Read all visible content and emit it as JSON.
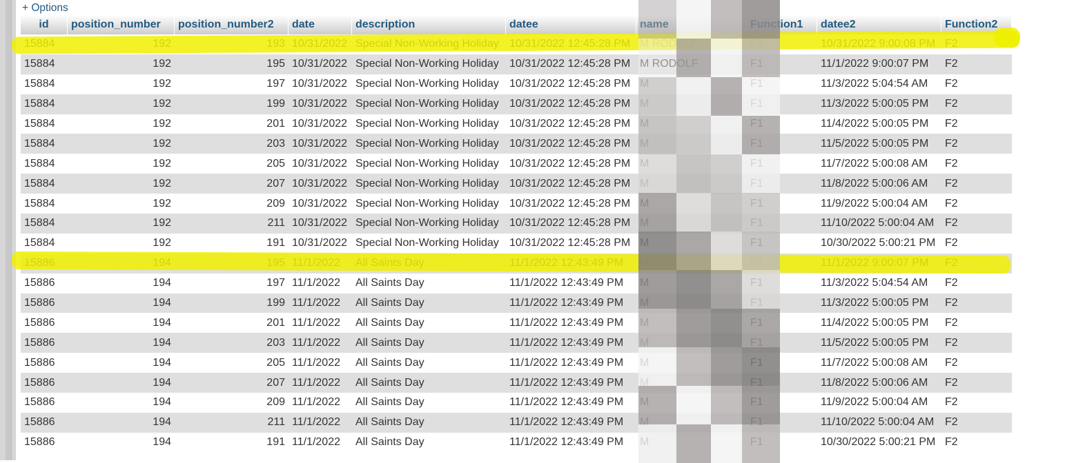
{
  "options_link": "+ Options",
  "columns": [
    "id",
    "position_number",
    "position_number2",
    "date",
    "description",
    "datee",
    "name",
    "Function1",
    "datee2",
    "Function2"
  ],
  "rows": [
    {
      "id": "15884",
      "position_number": "192",
      "position_number2": "193",
      "date": "10/31/2022",
      "description": "Special Non-Working Holiday",
      "datee": "10/31/2022 12:45:28 PM",
      "name": "M        RODOLF",
      "Function1": "F1",
      "datee2": "10/31/2022 9:00:08 PM",
      "Function2": "F2"
    },
    {
      "id": "15884",
      "position_number": "192",
      "position_number2": "195",
      "date": "10/31/2022",
      "description": "Special Non-Working Holiday",
      "datee": "10/31/2022 12:45:28 PM",
      "name": "M        RODOLF",
      "Function1": "F1",
      "datee2": "11/1/2022 9:00:07 PM",
      "Function2": "F2"
    },
    {
      "id": "15884",
      "position_number": "192",
      "position_number2": "197",
      "date": "10/31/2022",
      "description": "Special Non-Working Holiday",
      "datee": "10/31/2022 12:45:28 PM",
      "name": "M",
      "Function1": "F1",
      "datee2": "11/3/2022 5:04:54 AM",
      "Function2": "F2"
    },
    {
      "id": "15884",
      "position_number": "192",
      "position_number2": "199",
      "date": "10/31/2022",
      "description": "Special Non-Working Holiday",
      "datee": "10/31/2022 12:45:28 PM",
      "name": "M",
      "Function1": "F1",
      "datee2": "11/3/2022 5:00:05 PM",
      "Function2": "F2"
    },
    {
      "id": "15884",
      "position_number": "192",
      "position_number2": "201",
      "date": "10/31/2022",
      "description": "Special Non-Working Holiday",
      "datee": "10/31/2022 12:45:28 PM",
      "name": "M",
      "Function1": "F1",
      "datee2": "11/4/2022 5:00:05 PM",
      "Function2": "F2"
    },
    {
      "id": "15884",
      "position_number": "192",
      "position_number2": "203",
      "date": "10/31/2022",
      "description": "Special Non-Working Holiday",
      "datee": "10/31/2022 12:45:28 PM",
      "name": "M",
      "Function1": "F1",
      "datee2": "11/5/2022 5:00:05 PM",
      "Function2": "F2"
    },
    {
      "id": "15884",
      "position_number": "192",
      "position_number2": "205",
      "date": "10/31/2022",
      "description": "Special Non-Working Holiday",
      "datee": "10/31/2022 12:45:28 PM",
      "name": "M",
      "Function1": "F1",
      "datee2": "11/7/2022 5:00:08 AM",
      "Function2": "F2"
    },
    {
      "id": "15884",
      "position_number": "192",
      "position_number2": "207",
      "date": "10/31/2022",
      "description": "Special Non-Working Holiday",
      "datee": "10/31/2022 12:45:28 PM",
      "name": "M",
      "Function1": "F1",
      "datee2": "11/8/2022 5:00:06 AM",
      "Function2": "F2"
    },
    {
      "id": "15884",
      "position_number": "192",
      "position_number2": "209",
      "date": "10/31/2022",
      "description": "Special Non-Working Holiday",
      "datee": "10/31/2022 12:45:28 PM",
      "name": "M",
      "Function1": "F1",
      "datee2": "11/9/2022 5:00:04 AM",
      "Function2": "F2"
    },
    {
      "id": "15884",
      "position_number": "192",
      "position_number2": "211",
      "date": "10/31/2022",
      "description": "Special Non-Working Holiday",
      "datee": "10/31/2022 12:45:28 PM",
      "name": "M",
      "Function1": "F1",
      "datee2": "11/10/2022 5:00:04 AM",
      "Function2": "F2"
    },
    {
      "id": "15884",
      "position_number": "192",
      "position_number2": "191",
      "date": "10/31/2022",
      "description": "Special Non-Working Holiday",
      "datee": "10/31/2022 12:45:28 PM",
      "name": "M",
      "Function1": "F1",
      "datee2": "10/30/2022 5:00:21 PM",
      "Function2": "F2"
    },
    {
      "id": "15886",
      "position_number": "194",
      "position_number2": "195",
      "date": "11/1/2022",
      "description": "All Saints Day",
      "datee": "11/1/2022 12:43:49 PM",
      "name": "M",
      "Function1": "F1",
      "datee2": "11/1/2022 9:00:07 PM",
      "Function2": "F2"
    },
    {
      "id": "15886",
      "position_number": "194",
      "position_number2": "197",
      "date": "11/1/2022",
      "description": "All Saints Day",
      "datee": "11/1/2022 12:43:49 PM",
      "name": "M",
      "Function1": "F1",
      "datee2": "11/3/2022 5:04:54 AM",
      "Function2": "F2"
    },
    {
      "id": "15886",
      "position_number": "194",
      "position_number2": "199",
      "date": "11/1/2022",
      "description": "All Saints Day",
      "datee": "11/1/2022 12:43:49 PM",
      "name": "M",
      "Function1": "F1",
      "datee2": "11/3/2022 5:00:05 PM",
      "Function2": "F2"
    },
    {
      "id": "15886",
      "position_number": "194",
      "position_number2": "201",
      "date": "11/1/2022",
      "description": "All Saints Day",
      "datee": "11/1/2022 12:43:49 PM",
      "name": "M",
      "Function1": "F1",
      "datee2": "11/4/2022 5:00:05 PM",
      "Function2": "F2"
    },
    {
      "id": "15886",
      "position_number": "194",
      "position_number2": "203",
      "date": "11/1/2022",
      "description": "All Saints Day",
      "datee": "11/1/2022 12:43:49 PM",
      "name": "M",
      "Function1": "F1",
      "datee2": "11/5/2022 5:00:05 PM",
      "Function2": "F2"
    },
    {
      "id": "15886",
      "position_number": "194",
      "position_number2": "205",
      "date": "11/1/2022",
      "description": "All Saints Day",
      "datee": "11/1/2022 12:43:49 PM",
      "name": "M",
      "Function1": "F1",
      "datee2": "11/7/2022 5:00:08 AM",
      "Function2": "F2"
    },
    {
      "id": "15886",
      "position_number": "194",
      "position_number2": "207",
      "date": "11/1/2022",
      "description": "All Saints Day",
      "datee": "11/1/2022 12:43:49 PM",
      "name": "M",
      "Function1": "F1",
      "datee2": "11/8/2022 5:00:06 AM",
      "Function2": "F2"
    },
    {
      "id": "15886",
      "position_number": "194",
      "position_number2": "209",
      "date": "11/1/2022",
      "description": "All Saints Day",
      "datee": "11/1/2022 12:43:49 PM",
      "name": "M",
      "Function1": "F1",
      "datee2": "11/9/2022 5:00:04 AM",
      "Function2": "F2"
    },
    {
      "id": "15886",
      "position_number": "194",
      "position_number2": "211",
      "date": "11/1/2022",
      "description": "All Saints Day",
      "datee": "11/1/2022 12:43:49 PM",
      "name": "M",
      "Function1": "F1",
      "datee2": "11/10/2022 5:00:04 AM",
      "Function2": "F2"
    },
    {
      "id": "15886",
      "position_number": "194",
      "position_number2": "191",
      "date": "11/1/2022",
      "description": "All Saints Day",
      "datee": "11/1/2022 12:43:49 PM",
      "name": "M",
      "Function1": "F1",
      "datee2": "10/30/2022 5:00:21 PM",
      "Function2": "F2"
    }
  ],
  "colors": {
    "link": "#235a81",
    "row_alt": "#dfdfdf",
    "highlight": "#f0f000"
  }
}
